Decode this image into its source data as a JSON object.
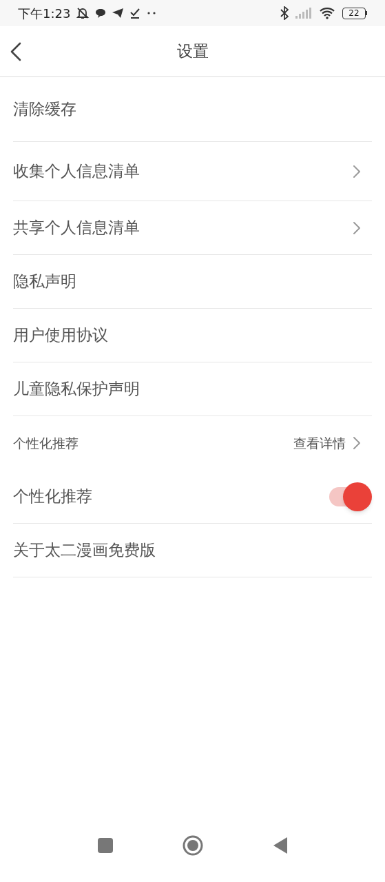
{
  "status_bar": {
    "time": "下午1:23",
    "battery": "22"
  },
  "header": {
    "title": "设置"
  },
  "items": [
    {
      "kind": "plain",
      "label": "清除缓存"
    },
    {
      "kind": "link",
      "label": "收集个人信息清单"
    },
    {
      "kind": "link",
      "label": "共享个人信息清单"
    },
    {
      "kind": "plain",
      "label": "隐私声明"
    },
    {
      "kind": "plain",
      "label": "用户使用协议"
    },
    {
      "kind": "plain",
      "label": "儿童隐私保护声明"
    },
    {
      "kind": "section",
      "label": "个性化推荐",
      "action": "查看详情"
    },
    {
      "kind": "toggle",
      "label": "个性化推荐",
      "on": true
    },
    {
      "kind": "plain",
      "label": "关于太二漫画免费版"
    }
  ]
}
